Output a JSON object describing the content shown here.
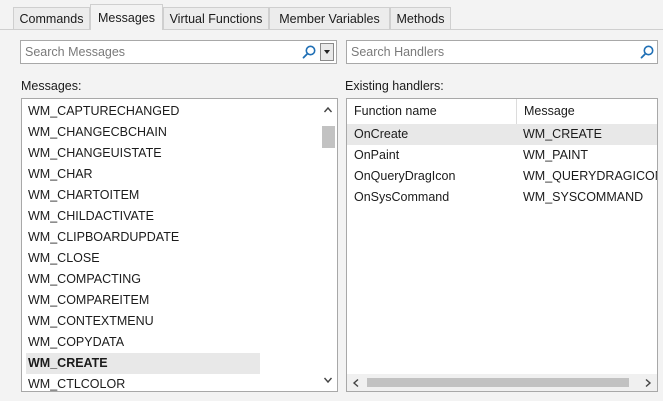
{
  "tabs": [
    {
      "label": "Commands",
      "active": false
    },
    {
      "label": "Messages",
      "active": true
    },
    {
      "label": "Virtual Functions",
      "active": false
    },
    {
      "label": "Member Variables",
      "active": false
    },
    {
      "label": "Methods",
      "active": false
    }
  ],
  "messages_search": {
    "placeholder": "Search Messages"
  },
  "handlers_search": {
    "placeholder": "Search Handlers"
  },
  "messages_label": "Messages:",
  "handlers_label": "Existing handlers:",
  "messages": [
    "WM_CAPTURECHANGED",
    "WM_CHANGECBCHAIN",
    "WM_CHANGEUISTATE",
    "WM_CHAR",
    "WM_CHARTOITEM",
    "WM_CHILDACTIVATE",
    "WM_CLIPBOARDUPDATE",
    "WM_CLOSE",
    "WM_COMPACTING",
    "WM_COMPAREITEM",
    "WM_CONTEXTMENU",
    "WM_COPYDATA",
    "WM_CREATE",
    "WM_CTLCOLOR"
  ],
  "selected_message": "WM_CREATE",
  "handlers_table": {
    "columns": [
      "Function name",
      "Message"
    ],
    "rows": [
      {
        "function": "OnCreate",
        "message": "WM_CREATE",
        "selected": true
      },
      {
        "function": "OnPaint",
        "message": "WM_PAINT",
        "selected": false
      },
      {
        "function": "OnQueryDragIcon",
        "message": "WM_QUERYDRAGICON",
        "selected": false
      },
      {
        "function": "OnSysCommand",
        "message": "WM_SYSCOMMAND",
        "selected": false
      }
    ]
  },
  "icons": {
    "search": "search-icon",
    "dropdown": "chevron-down-icon",
    "scroll_up": "chevron-up-icon",
    "scroll_down": "chevron-down-icon",
    "scroll_left": "chevron-left-icon",
    "scroll_right": "chevron-right-icon"
  }
}
